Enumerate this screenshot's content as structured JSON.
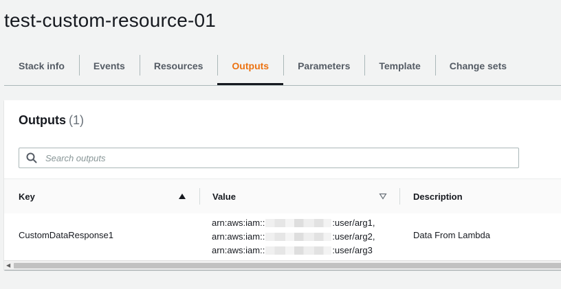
{
  "page": {
    "title": "test-custom-resource-01"
  },
  "tabs": [
    {
      "label": "Stack info",
      "active": false
    },
    {
      "label": "Events",
      "active": false
    },
    {
      "label": "Resources",
      "active": false
    },
    {
      "label": "Outputs",
      "active": true
    },
    {
      "label": "Parameters",
      "active": false
    },
    {
      "label": "Template",
      "active": false
    },
    {
      "label": "Change sets",
      "active": false
    }
  ],
  "outputs": {
    "header": "Outputs",
    "count": "(1)",
    "search_placeholder": "Search outputs",
    "columns": {
      "key": "Key",
      "value": "Value",
      "description": "Description"
    },
    "rows": [
      {
        "key": "CustomDataResponse1",
        "value_lines": [
          {
            "prefix": "arn:aws:iam::",
            "suffix": ":user/arg1,"
          },
          {
            "prefix": "arn:aws:iam::",
            "suffix": ":user/arg2,"
          },
          {
            "prefix": "arn:aws:iam::",
            "suffix": ":user/arg3"
          }
        ],
        "description": "Data From Lambda"
      }
    ]
  },
  "colors": {
    "accent": "#ec7211",
    "text": "#16191f",
    "muted": "#545b64",
    "background": "#f2f3f3"
  },
  "icons": {
    "search": "search-icon",
    "sort_ascending": "sort-ascending-icon",
    "sort_descending": "sort-descending-icon"
  }
}
